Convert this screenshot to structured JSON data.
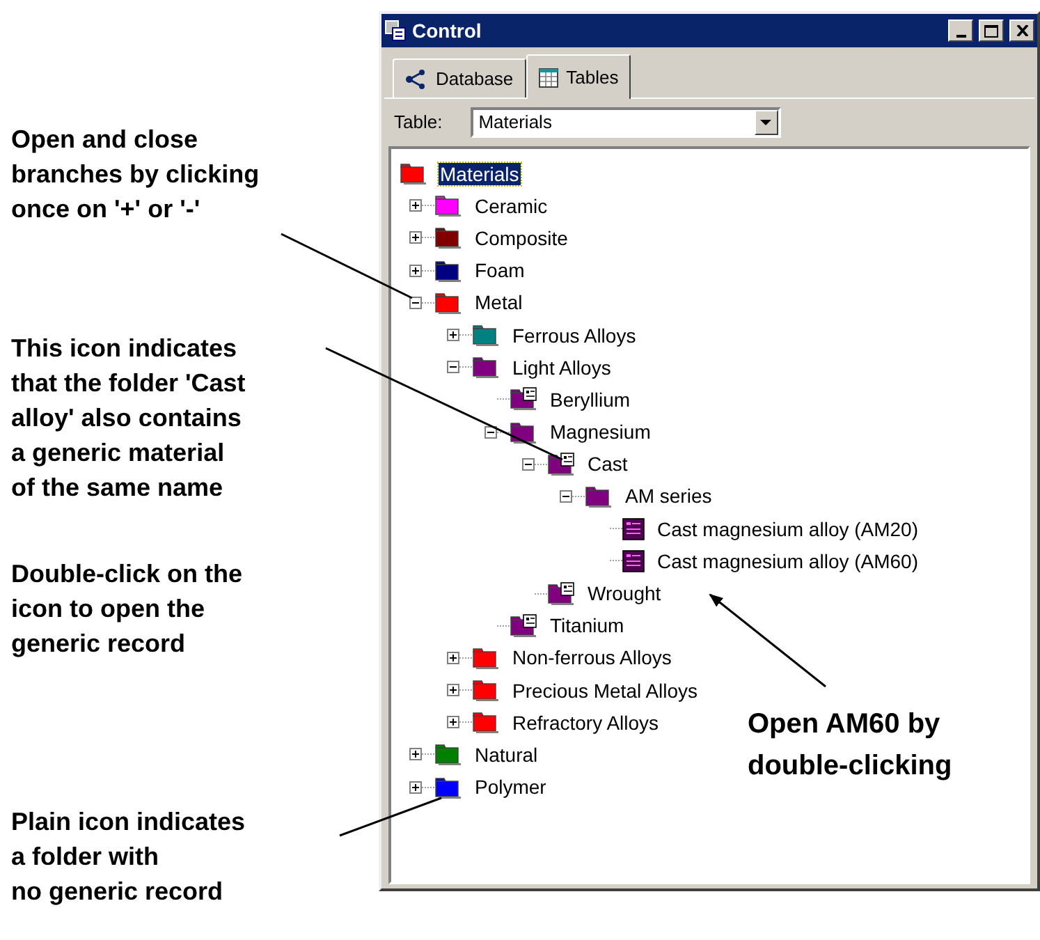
{
  "window": {
    "title": "Control"
  },
  "tabs": [
    {
      "label": "Database",
      "selected": false,
      "kind": "database"
    },
    {
      "label": "Tables",
      "selected": true,
      "kind": "tables"
    }
  ],
  "table_selector": {
    "label": "Table:",
    "value": "Materials"
  },
  "tree": [
    {
      "label": "Materials",
      "kind": "folder",
      "color": "#ff0000",
      "selected": true,
      "children": [
        {
          "label": "Ceramic",
          "kind": "folder",
          "color": "#ff00ff",
          "selected": false,
          "expanded": false
        },
        {
          "label": "Composite",
          "kind": "folder",
          "color": "#800000",
          "selected": false,
          "expanded": false
        },
        {
          "label": "Foam",
          "kind": "folder",
          "color": "#000080",
          "selected": false,
          "expanded": false
        },
        {
          "label": "Metal",
          "kind": "folder",
          "color": "#ff0000",
          "selected": false,
          "expanded": true,
          "children": [
            {
              "label": "Ferrous Alloys",
              "kind": "folder",
              "color": "#008080",
              "selected": false,
              "expanded": false
            },
            {
              "label": "Light Alloys",
              "kind": "folder",
              "color": "#800080",
              "selected": false,
              "expanded": true,
              "children": [
                {
                  "label": "Beryllium",
                  "kind": "generic-folder",
                  "color": "#800080",
                  "selected": false
                },
                {
                  "label": "Magnesium",
                  "kind": "folder",
                  "color": "#800080",
                  "selected": false,
                  "expanded": true,
                  "children": [
                    {
                      "label": "Cast",
                      "kind": "generic-folder",
                      "color": "#800080",
                      "selected": false,
                      "expanded": true,
                      "children": [
                        {
                          "label": "AM series",
                          "kind": "folder",
                          "color": "#800080",
                          "selected": false,
                          "expanded": true,
                          "children": [
                            {
                              "label": "Cast magnesium alloy (AM20)",
                              "kind": "record",
                              "color": "#500050",
                              "selected": false
                            },
                            {
                              "label": "Cast magnesium alloy (AM60)",
                              "kind": "record",
                              "color": "#500050",
                              "selected": false
                            }
                          ]
                        }
                      ]
                    },
                    {
                      "label": "Wrought",
                      "kind": "generic-folder",
                      "color": "#800080",
                      "selected": false
                    }
                  ]
                },
                {
                  "label": "Titanium",
                  "kind": "generic-folder",
                  "color": "#800080",
                  "selected": false
                }
              ]
            },
            {
              "label": "Non-ferrous Alloys",
              "kind": "folder",
              "color": "#ff0000",
              "selected": false,
              "expanded": false
            },
            {
              "label": "Precious Metal Alloys",
              "kind": "folder",
              "color": "#ff0000",
              "selected": false,
              "expanded": false
            },
            {
              "label": "Refractory Alloys",
              "kind": "folder",
              "color": "#ff0000",
              "selected": false,
              "expanded": false
            }
          ]
        },
        {
          "label": "Natural",
          "kind": "folder",
          "color": "#008000",
          "selected": false,
          "expanded": false
        },
        {
          "label": "Polymer",
          "kind": "folder",
          "color": "#0000ff",
          "selected": false,
          "expanded": false
        }
      ]
    }
  ],
  "callouts": [
    {
      "text": "Open and close\nbranches by clicking\nonce on '+' or '-'"
    },
    {
      "text": "This icon indicates\nthat the folder 'Cast\nalloy' also contains\na generic material\nof the same name"
    },
    {
      "text": "Double-click on the\nicon to open the\ngeneric record"
    },
    {
      "text": "Plain icon indicates\na folder with\nno generic record"
    },
    {
      "text": "Open AM60 by\ndouble-clicking"
    }
  ]
}
